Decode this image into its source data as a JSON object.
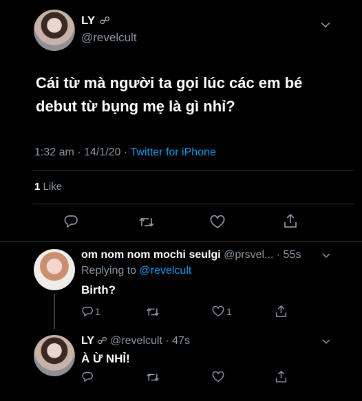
{
  "main_tweet": {
    "display_name": "LY",
    "name_glyph": "☍",
    "handle": "@revelcult",
    "text_line1": "Cái từ mà người ta gọi lúc các em bé",
    "text_line2": "debut từ bụng mẹ là gì nhỉ?",
    "time": "1:32 am",
    "sep1": "·",
    "date": "14/1/20",
    "sep2": "·",
    "source": "Twitter for iPhone",
    "likes_count": "1",
    "likes_label": "Like"
  },
  "reply1": {
    "display_name": "om nom nom mochi seulgi",
    "handle": "@prsvel...",
    "sep": "·",
    "time": "55s",
    "replying_prefix": "Replying to",
    "replying_to": "@revelcult",
    "text": "Birth?",
    "reply_count": "1",
    "like_count": "1"
  },
  "reply2": {
    "display_name": "LY",
    "name_glyph": "☍",
    "handle": "@revelcult",
    "sep": "·",
    "time": "47s",
    "text": "À Ừ NHỈ!"
  },
  "colors": {
    "background": "#000000",
    "text": "#ffffff",
    "muted": "#8b98a5",
    "link": "#1d9bf0",
    "divider": "#2f3336"
  }
}
